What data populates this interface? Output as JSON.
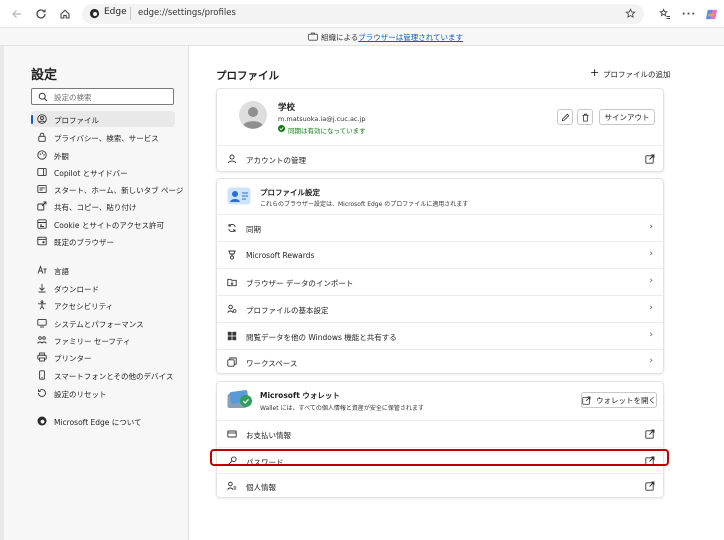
{
  "browser": {
    "site_label": "Edge",
    "url": "edge://settings/profiles"
  },
  "banner": {
    "prefix": "組織による",
    "link": "ブラウザーは管理されています"
  },
  "sidebar": {
    "title": "設定",
    "search_placeholder": "設定の検索",
    "items": [
      {
        "label": "プロファイル",
        "icon": "person-icon"
      },
      {
        "label": "プライバシー、検索、サービス",
        "icon": "lock-icon"
      },
      {
        "label": "外観",
        "icon": "appearance-icon"
      },
      {
        "label": "Copilot とサイドバー",
        "icon": "sidebar-icon"
      },
      {
        "label": "スタート、ホーム、新しいタブ ページ",
        "icon": "home-tab-icon"
      },
      {
        "label": "共有、コピー、貼り付け",
        "icon": "share-icon"
      },
      {
        "label": "Cookie とサイトのアクセス許可",
        "icon": "cookie-icon"
      },
      {
        "label": "既定のブラウザー",
        "icon": "browser-icon"
      },
      {
        "label": "言語",
        "icon": "language-icon"
      },
      {
        "label": "ダウンロード",
        "icon": "download-icon"
      },
      {
        "label": "アクセシビリティ",
        "icon": "accessibility-icon"
      },
      {
        "label": "システムとパフォーマンス",
        "icon": "system-icon"
      },
      {
        "label": "ファミリー セーフティ",
        "icon": "family-icon"
      },
      {
        "label": "プリンター",
        "icon": "printer-icon"
      },
      {
        "label": "スマートフォンとその他のデバイス",
        "icon": "phone-icon"
      },
      {
        "label": "設定のリセット",
        "icon": "reset-icon"
      },
      {
        "label": "Microsoft Edge について",
        "icon": "edge-logo-icon"
      }
    ]
  },
  "main": {
    "title": "プロファイル",
    "add_profile": "プロファイルの追加",
    "profile": {
      "name": "学校",
      "email": "m.matsuoka.ia@j.cuc.ac.jp",
      "sync_status": "同期は有効になっています",
      "signout": "サインアウト",
      "manage_account": "アカウントの管理"
    },
    "profile_settings": {
      "title": "プロファイル設定",
      "subtitle": "これらのブラウザー設定は、Microsoft Edge のプロファイルに適用されます",
      "rows": [
        {
          "label": "同期",
          "icon": "sync-icon"
        },
        {
          "label": "Microsoft Rewards",
          "icon": "rewards-icon"
        },
        {
          "label": "ブラウザー データのインポート",
          "icon": "import-icon"
        },
        {
          "label": "プロファイルの基本設定",
          "icon": "profile-prefs-icon"
        },
        {
          "label": "閲覧データを他の Windows 機能と共有する",
          "icon": "windows-icon"
        },
        {
          "label": "ワークスペース",
          "icon": "workspace-icon"
        }
      ]
    },
    "wallet": {
      "title": "Microsoft ウォレット",
      "subtitle": "Wallet には、すべての個人情報と資産が安全に保管されます",
      "open_button": "ウォレットを開く",
      "rows": [
        {
          "label": "お支払い情報",
          "icon": "card-icon"
        },
        {
          "label": "パスワード",
          "icon": "key-icon"
        },
        {
          "label": "個人情報",
          "icon": "personal-info-icon"
        }
      ]
    }
  },
  "colors": {
    "accent": "#0b5cc3",
    "highlight": "#c00000",
    "sync_green": "#107c10"
  }
}
